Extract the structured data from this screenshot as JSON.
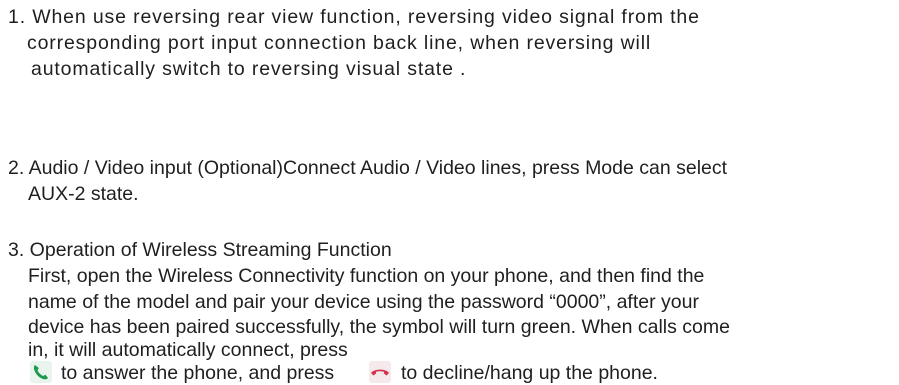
{
  "document": {
    "item1": {
      "line1": "1. When use reversing rear view function, reversing video signal from the",
      "line2": "corresponding port input connection back line, when reversing will",
      "line3": "automatically switch to reversing visual state ."
    },
    "item2": {
      "line1": "2. Audio / Video input (Optional)Connect Audio / Video lines, press Mode can select",
      "line2": "AUX-2 state."
    },
    "item3": {
      "line1": "3. Operation of Wireless Streaming Function",
      "line2": "First, open the Wireless Connectivity function on your phone, and then find the",
      "line3": "name of the model and pair your device using the password “0000”, after your",
      "line4": "device has been paired successfully, the symbol will turn green. When calls come",
      "line5": "in, it will automatically connect, press",
      "line6a": "to answer the phone, and press",
      "line6b": "to decline/hang up the phone."
    }
  },
  "icons": {
    "answer": {
      "name": "answer-call-icon",
      "color": "#1a9a4a"
    },
    "decline": {
      "name": "decline-call-icon",
      "color": "#d6304a"
    }
  }
}
